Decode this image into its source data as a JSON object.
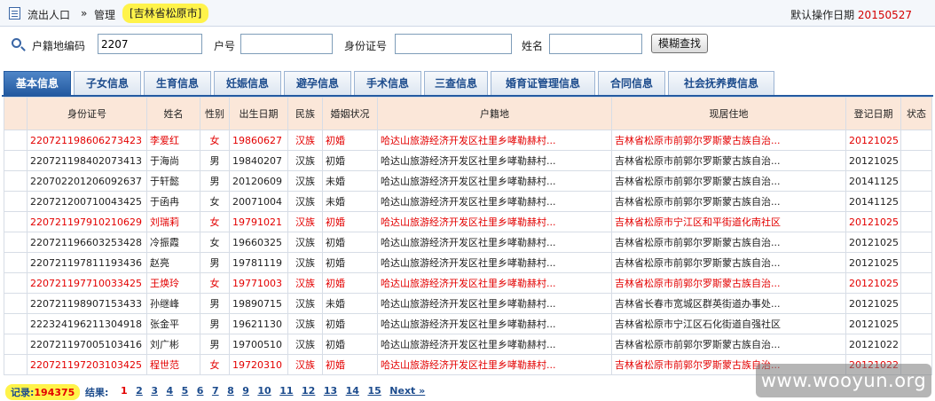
{
  "header": {
    "crumb_1": "流出人口",
    "sep": "»",
    "crumb_2": "管理",
    "region": "[吉林省松原市]",
    "op_date_label": "默认操作日期",
    "op_date_value": "20150527"
  },
  "search": {
    "code_label": "户籍地编码",
    "code_value": "2207",
    "hh_label": "户号",
    "hh_value": "",
    "id_label": "身份证号",
    "id_value": "",
    "name_label": "姓名",
    "name_value": "",
    "button": "模糊查找"
  },
  "tabs": [
    "基本信息",
    "子女信息",
    "生育信息",
    "妊娠信息",
    "避孕信息",
    "手术信息",
    "三查信息",
    "婚育证管理信息",
    "合同信息",
    "社会抚养费信息"
  ],
  "table": {
    "headers": [
      "",
      "身份证号",
      "姓名",
      "性别",
      "出生日期",
      "民族",
      "婚姻状况",
      "户籍地",
      "现居住地",
      "登记日期",
      "状态"
    ],
    "rows": [
      {
        "red": true,
        "cells": [
          "",
          "220721198606273423",
          "李爱红",
          "女",
          "19860627",
          "汉族",
          "初婚",
          "哈达山旅游经济开发区社里乡哮勒赫村...",
          "吉林省松原市前郭尔罗斯蒙古族自治...",
          "20121025",
          ""
        ]
      },
      {
        "red": false,
        "cells": [
          "",
          "220721198402073413",
          "于海尚",
          "男",
          "19840207",
          "汉族",
          "初婚",
          "哈达山旅游经济开发区社里乡哮勒赫村...",
          "吉林省松原市前郭尔罗斯蒙古族自治...",
          "20121025",
          ""
        ]
      },
      {
        "red": false,
        "cells": [
          "",
          "220702201206092637",
          "于轩懿",
          "男",
          "20120609",
          "汉族",
          "未婚",
          "哈达山旅游经济开发区社里乡哮勒赫村...",
          "吉林省松原市前郭尔罗斯蒙古族自治...",
          "20141125",
          ""
        ]
      },
      {
        "red": false,
        "cells": [
          "",
          "220721200710043425",
          "于函冉",
          "女",
          "20071004",
          "汉族",
          "未婚",
          "哈达山旅游经济开发区社里乡哮勒赫村...",
          "吉林省松原市前郭尔罗斯蒙古族自治...",
          "20141125",
          ""
        ]
      },
      {
        "red": true,
        "cells": [
          "",
          "220721197910210629",
          "刘瑞莉",
          "女",
          "19791021",
          "汉族",
          "初婚",
          "哈达山旅游经济开发区社里乡哮勒赫村...",
          "吉林省松原市宁江区和平街道化南社区",
          "20121025",
          ""
        ]
      },
      {
        "red": false,
        "cells": [
          "",
          "220721196603253428",
          "冷振霞",
          "女",
          "19660325",
          "汉族",
          "初婚",
          "哈达山旅游经济开发区社里乡哮勒赫村...",
          "吉林省松原市前郭尔罗斯蒙古族自治...",
          "20121025",
          ""
        ]
      },
      {
        "red": false,
        "cells": [
          "",
          "220721197811193436",
          "赵亮",
          "男",
          "19781119",
          "汉族",
          "初婚",
          "哈达山旅游经济开发区社里乡哮勒赫村...",
          "吉林省松原市前郭尔罗斯蒙古族自治...",
          "20121025",
          ""
        ]
      },
      {
        "red": true,
        "cells": [
          "",
          "220721197710033425",
          "王焕玲",
          "女",
          "19771003",
          "汉族",
          "初婚",
          "哈达山旅游经济开发区社里乡哮勒赫村...",
          "吉林省松原市前郭尔罗斯蒙古族自治...",
          "20121025",
          ""
        ]
      },
      {
        "red": false,
        "cells": [
          "",
          "220721198907153433",
          "孙继峰",
          "男",
          "19890715",
          "汉族",
          "未婚",
          "哈达山旅游经济开发区社里乡哮勒赫村...",
          "吉林省长春市宽城区群英街道办事处...",
          "20121025",
          ""
        ]
      },
      {
        "red": false,
        "cells": [
          "",
          "222324196211304918",
          "张金平",
          "男",
          "19621130",
          "汉族",
          "初婚",
          "哈达山旅游经济开发区社里乡哮勒赫村...",
          "吉林省松原市宁江区石化街道自强社区",
          "20121025",
          ""
        ]
      },
      {
        "red": false,
        "cells": [
          "",
          "220721197005103416",
          "刘广彬",
          "男",
          "19700510",
          "汉族",
          "初婚",
          "哈达山旅游经济开发区社里乡哮勒赫村...",
          "吉林省松原市前郭尔罗斯蒙古族自治...",
          "20121022",
          ""
        ]
      },
      {
        "red": true,
        "cells": [
          "",
          "220721197203103425",
          "程世范",
          "女",
          "19720310",
          "汉族",
          "初婚",
          "哈达山旅游经济开发区社里乡哮勒赫村...",
          "吉林省松原市前郭尔罗斯蒙古族自治...",
          "20121022",
          ""
        ]
      }
    ]
  },
  "footer": {
    "record_label": "记录:",
    "record_count": "194375",
    "result_label": "结果:",
    "pages": [
      "1",
      "2",
      "3",
      "4",
      "5",
      "6",
      "7",
      "8",
      "9",
      "10",
      "11",
      "12",
      "13",
      "14",
      "15"
    ],
    "next": "Next »"
  },
  "watermark": "www.wooyun.org"
}
